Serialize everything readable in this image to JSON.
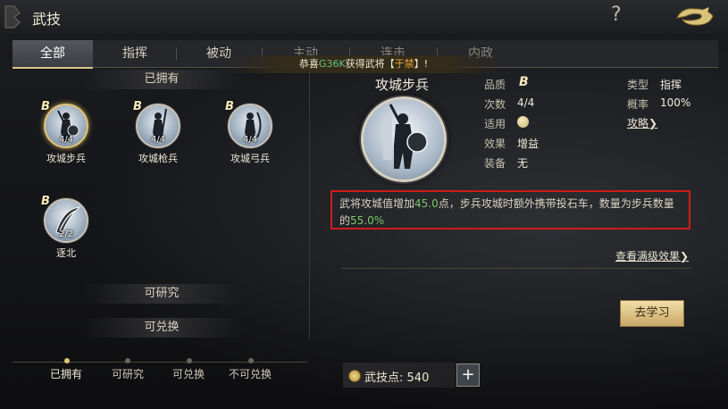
{
  "header": {
    "title": "武技",
    "help_icon": "question-mark-icon",
    "close_icon": "dragon-return-icon"
  },
  "tabs": [
    {
      "label": "全部",
      "active": true
    },
    {
      "label": "指挥"
    },
    {
      "label": "被动"
    },
    {
      "label": "主动"
    },
    {
      "label": "连击"
    },
    {
      "label": "内政"
    }
  ],
  "notice": {
    "prefix": "恭喜",
    "player": "G36K",
    "middle": "获得武将【",
    "general": "于禁",
    "suffix": "】!"
  },
  "owned": {
    "header": "已拥有",
    "skills": [
      {
        "grade": "B",
        "count": "4/4",
        "name": "攻城步兵",
        "selected": true
      },
      {
        "grade": "B",
        "count": "4/4",
        "name": "攻城枪兵"
      },
      {
        "grade": "B",
        "count": "4/4",
        "name": "攻城弓兵"
      },
      {
        "grade": "B",
        "count": "2/2",
        "name": "逐北"
      }
    ]
  },
  "sections": {
    "researchable": "可研究",
    "exchangeable": "可兑换"
  },
  "detail": {
    "name": "攻城步兵",
    "attrs": {
      "quality_label": "品质",
      "quality_value": "B",
      "times_label": "次数",
      "times_value": "4/4",
      "applicable_label": "适用",
      "effect_label": "效果",
      "effect_value": "增益",
      "equip_label": "装备",
      "equip_value": "无",
      "type_label": "类型",
      "type_value": "指挥",
      "rate_label": "概率",
      "rate_value": "100%",
      "strategy_link": "攻略❯"
    },
    "description": {
      "p1": "武将攻城值增加",
      "v1": "45.0",
      "p2": "点，步兵攻城时额外携带投石车，数量为步兵数量的",
      "v2": "55.0%"
    },
    "max_effect_link": "查看满级效果❯",
    "learn_button": "去学习"
  },
  "filters": [
    {
      "label": "已拥有",
      "active": true
    },
    {
      "label": "可研究"
    },
    {
      "label": "可兑换"
    },
    {
      "label": "不可兑换"
    }
  ],
  "points": {
    "label": "武技点:",
    "value": "540",
    "plus": "+"
  },
  "colors": {
    "accent_gold": "#e0c47a",
    "highlight_green": "#7bc66a",
    "annotation_red": "#d01b1b"
  }
}
